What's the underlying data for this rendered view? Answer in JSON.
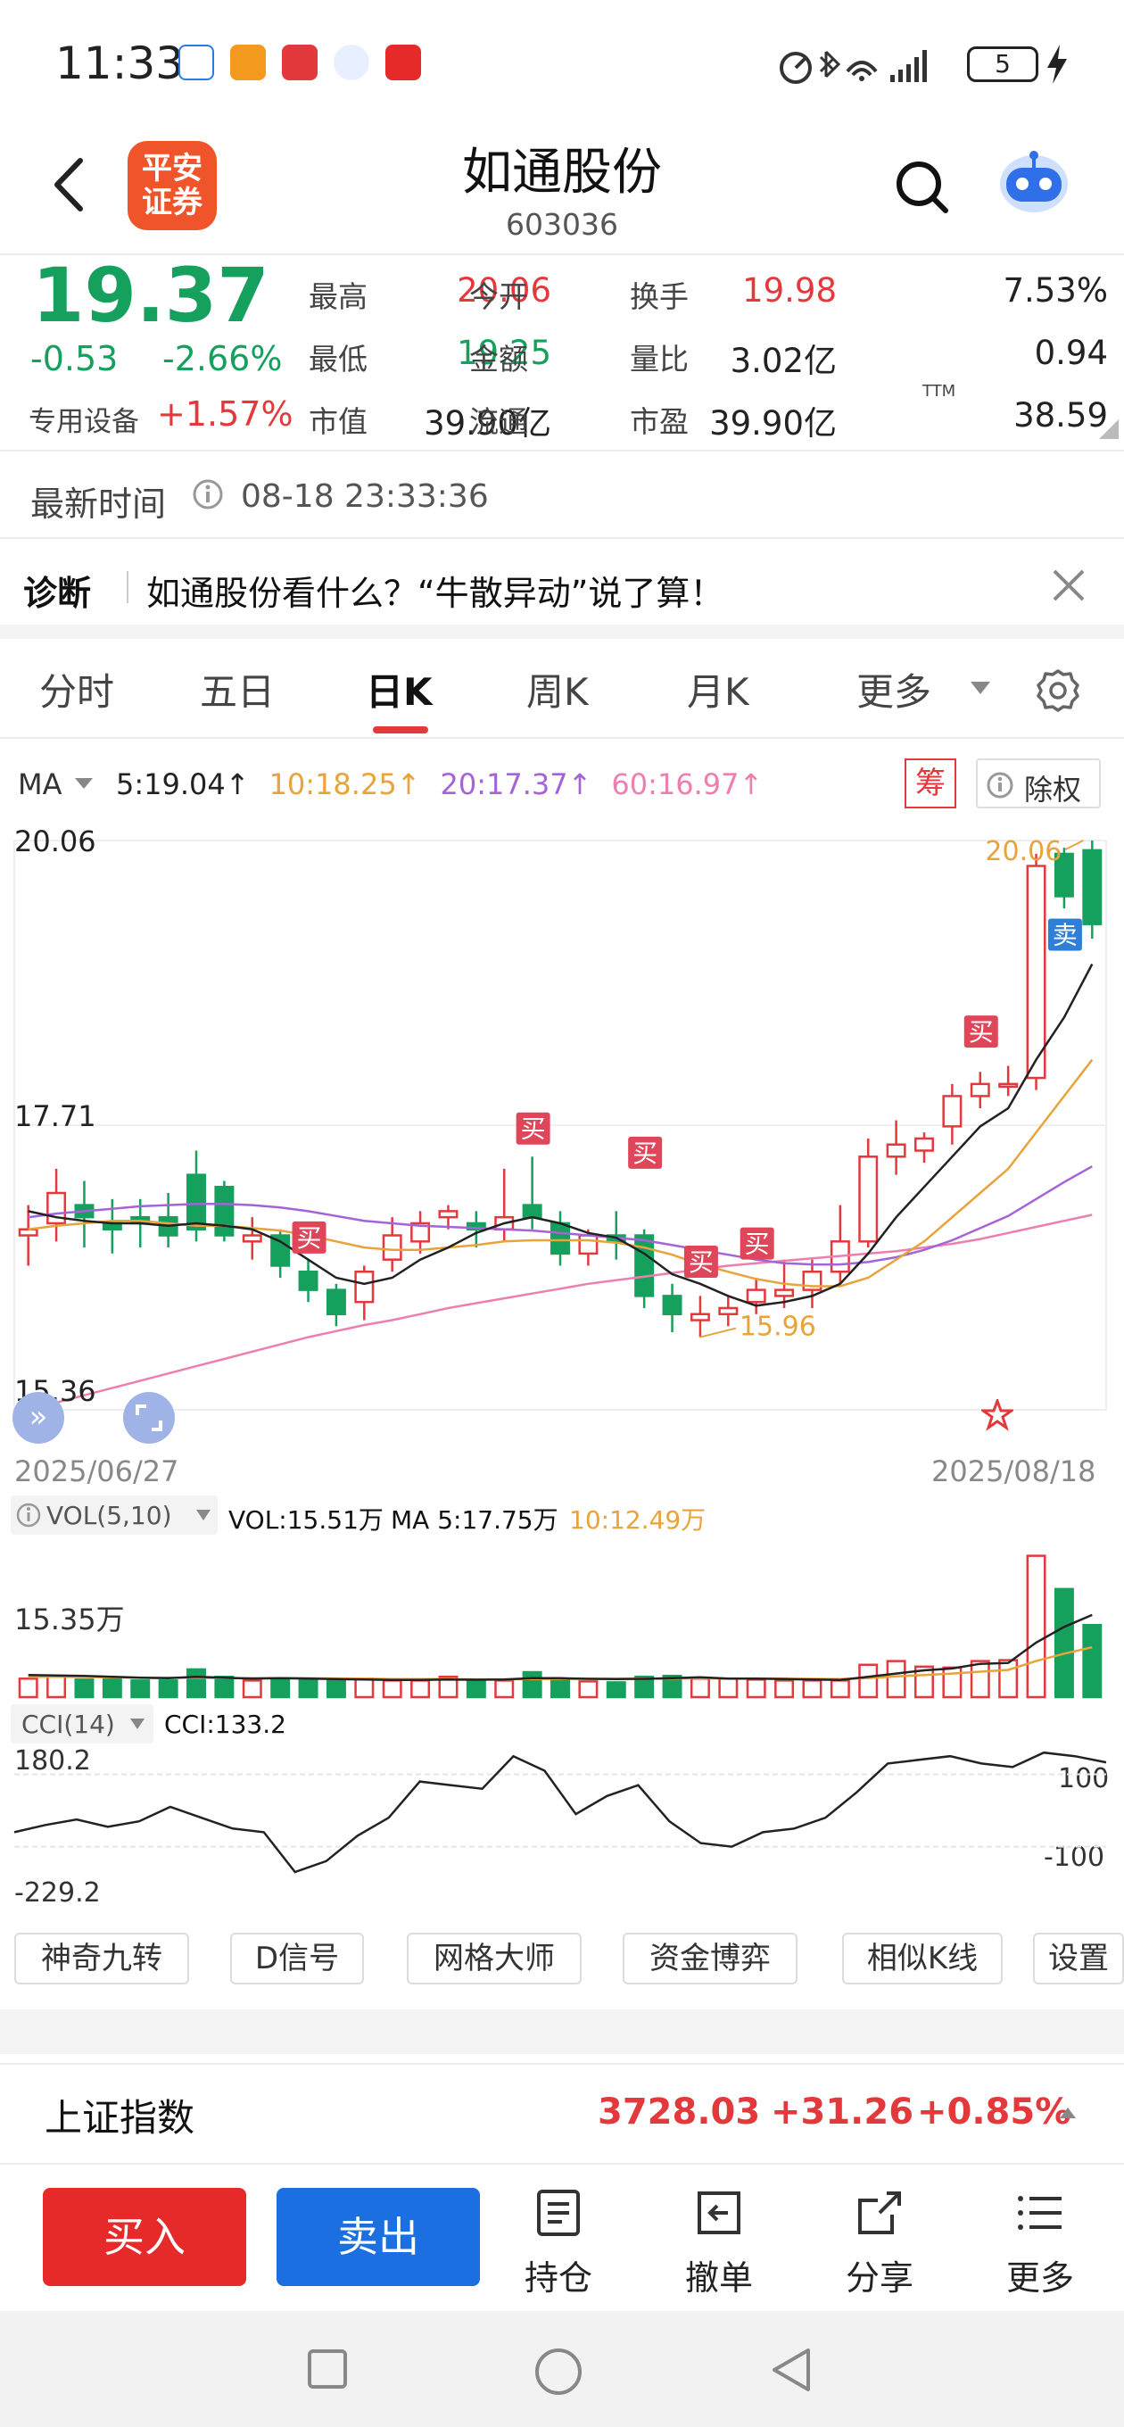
{
  "status_bar": {
    "time": "11:33",
    "battery": "5"
  },
  "header": {
    "logo_text": "平安证券",
    "stock_name": "如通股份",
    "stock_code": "603036"
  },
  "quote": {
    "price": "19.37",
    "change": "-0.53",
    "change_pct": "-2.66%",
    "sector_name": "专用设备",
    "sector_pct": "+1.57%",
    "stats": [
      {
        "label": "最高",
        "value": "20.06",
        "color": "red"
      },
      {
        "label": "今开",
        "value": "19.98",
        "color": "red"
      },
      {
        "label": "换手",
        "value": "7.53%",
        "color": "black"
      },
      {
        "label": "最低",
        "value": "19.25",
        "color": "green"
      },
      {
        "label": "金额",
        "value": "3.02亿",
        "color": "black"
      },
      {
        "label": "量比",
        "value": "0.94",
        "color": "black"
      },
      {
        "label": "市值",
        "value": "39.90亿",
        "color": "black"
      },
      {
        "label": "流通",
        "value": "39.90亿",
        "color": "black"
      },
      {
        "label": "市盈",
        "value": "38.59",
        "color": "black"
      }
    ],
    "pe_superscript": "TTM"
  },
  "latest_time": {
    "label": "最新时间",
    "value": "08-18 23:33:36"
  },
  "diagnosis": {
    "tag": "诊断",
    "text": "如通股份看什么？“牛散异动”说了算！"
  },
  "tabs": [
    "分时",
    "五日",
    "日K",
    "周K",
    "月K",
    "更多"
  ],
  "active_tab": "日K",
  "ma_legend": {
    "label": "MA",
    "items": [
      {
        "text": "5:19.04",
        "color": "#222222"
      },
      {
        "text": "10:18.25",
        "color": "#e8a33b"
      },
      {
        "text": "20:17.37",
        "color": "#a463d6"
      },
      {
        "text": "60:16.97",
        "color": "#ec7fb0"
      }
    ],
    "chip_label": "筹",
    "exright_label": "除权"
  },
  "chart_data": {
    "type": "candlestick",
    "y_ticks": [
      "20.06",
      "17.71",
      "15.36"
    ],
    "x_labels": [
      "2025/06/27",
      "2025/08/18"
    ],
    "high_marker": "20.06",
    "low_marker": "15.96",
    "buy_label": "买",
    "sell_label": "卖",
    "candles": [
      [
        16.8,
        16.85,
        16.55,
        17.05
      ],
      [
        16.9,
        17.15,
        16.75,
        17.35
      ],
      [
        17.05,
        16.95,
        16.7,
        17.25
      ],
      [
        16.9,
        16.85,
        16.65,
        17.1
      ],
      [
        16.95,
        16.9,
        16.7,
        17.1
      ],
      [
        16.95,
        16.8,
        16.7,
        17.15
      ],
      [
        17.3,
        16.85,
        16.75,
        17.5
      ],
      [
        17.2,
        16.8,
        16.75,
        17.25
      ],
      [
        16.75,
        16.8,
        16.6,
        16.95
      ],
      [
        16.8,
        16.55,
        16.45,
        16.85
      ],
      [
        16.5,
        16.35,
        16.25,
        16.6
      ],
      [
        16.35,
        16.15,
        16.05,
        16.4
      ],
      [
        16.25,
        16.5,
        16.1,
        16.55
      ],
      [
        16.6,
        16.8,
        16.5,
        16.95
      ],
      [
        16.75,
        16.9,
        16.65,
        17.0
      ],
      [
        16.95,
        17.0,
        16.85,
        17.05
      ],
      [
        16.9,
        16.85,
        16.7,
        17.0
      ],
      [
        16.85,
        16.95,
        16.75,
        17.35
      ],
      [
        17.05,
        16.95,
        16.85,
        17.45
      ],
      [
        16.9,
        16.65,
        16.55,
        17.0
      ],
      [
        16.65,
        16.8,
        16.55,
        16.85
      ],
      [
        16.8,
        16.75,
        16.6,
        17.0
      ],
      [
        16.8,
        16.3,
        16.2,
        16.85
      ],
      [
        16.3,
        16.15,
        16.0,
        16.4
      ],
      [
        16.1,
        16.15,
        15.96,
        16.3
      ],
      [
        16.15,
        16.2,
        16.05,
        16.3
      ],
      [
        16.25,
        16.35,
        16.15,
        16.45
      ],
      [
        16.3,
        16.35,
        16.2,
        16.6
      ],
      [
        16.35,
        16.5,
        16.2,
        16.6
      ],
      [
        16.5,
        16.75,
        16.4,
        17.05
      ],
      [
        16.75,
        17.45,
        16.7,
        17.6
      ],
      [
        17.45,
        17.55,
        17.3,
        17.75
      ],
      [
        17.5,
        17.6,
        17.4,
        17.65
      ],
      [
        17.7,
        17.95,
        17.55,
        18.05
      ],
      [
        17.95,
        18.05,
        17.85,
        18.15
      ],
      [
        18.05,
        18.05,
        17.95,
        18.2
      ],
      [
        18.1,
        19.85,
        18.0,
        19.95
      ],
      [
        19.95,
        19.6,
        19.5,
        20.0
      ],
      [
        19.98,
        19.37,
        19.25,
        20.06
      ]
    ],
    "ma5": [
      17.0,
      16.95,
      16.92,
      16.9,
      16.9,
      16.88,
      16.9,
      16.88,
      16.85,
      16.75,
      16.6,
      16.45,
      16.4,
      16.45,
      16.6,
      16.7,
      16.82,
      16.9,
      16.95,
      16.9,
      16.82,
      16.78,
      16.65,
      16.48,
      16.4,
      16.3,
      16.22,
      16.25,
      16.3,
      16.4,
      16.65,
      16.95,
      17.2,
      17.45,
      17.7,
      17.85,
      18.25,
      18.6,
      19.04
    ],
    "ma10": [
      16.85,
      16.88,
      16.9,
      16.92,
      16.92,
      16.9,
      16.88,
      16.88,
      16.86,
      16.84,
      16.8,
      16.75,
      16.7,
      16.68,
      16.68,
      16.7,
      16.72,
      16.75,
      16.76,
      16.76,
      16.76,
      16.74,
      16.7,
      16.64,
      16.56,
      16.5,
      16.44,
      16.4,
      16.38,
      16.38,
      16.45,
      16.6,
      16.75,
      16.95,
      17.15,
      17.35,
      17.65,
      17.95,
      18.25
    ],
    "ma20": [
      16.95,
      16.98,
      17.0,
      17.02,
      17.04,
      17.05,
      17.06,
      17.06,
      17.05,
      17.03,
      17.0,
      16.96,
      16.92,
      16.9,
      16.88,
      16.87,
      16.86,
      16.85,
      16.84,
      16.82,
      16.8,
      16.78,
      16.76,
      16.72,
      16.68,
      16.64,
      16.6,
      16.57,
      16.56,
      16.56,
      16.58,
      16.62,
      16.68,
      16.76,
      16.86,
      16.96,
      17.1,
      17.24,
      17.37
    ],
    "ma60": [
      15.36,
      15.42,
      15.48,
      15.54,
      15.6,
      15.66,
      15.72,
      15.78,
      15.84,
      15.9,
      15.96,
      16.01,
      16.06,
      16.1,
      16.15,
      16.2,
      16.24,
      16.28,
      16.32,
      16.36,
      16.4,
      16.43,
      16.46,
      16.49,
      16.52,
      16.55,
      16.57,
      16.59,
      16.61,
      16.63,
      16.65,
      16.67,
      16.7,
      16.73,
      16.77,
      16.82,
      16.87,
      16.92,
      16.97
    ],
    "signals": [
      {
        "index": 10,
        "type": "buy",
        "price": 16.65
      },
      {
        "index": 18,
        "type": "buy",
        "price": 17.55
      },
      {
        "index": 22,
        "type": "buy",
        "price": 17.35
      },
      {
        "index": 24,
        "type": "buy",
        "price": 16.45
      },
      {
        "index": 26,
        "type": "buy",
        "price": 16.6
      },
      {
        "index": 34,
        "type": "buy",
        "price": 18.35
      },
      {
        "index": 37,
        "type": "sell",
        "price": 19.15
      }
    ],
    "volume": {
      "label": "VOL(5,10)",
      "text": "VOL:15.51万",
      "ma5_text": "MA 5:17.75万",
      "ma10_text": "10:12.49万",
      "y_tick": "15.35万",
      "values": [
        2.0,
        2.3,
        1.9,
        1.9,
        1.8,
        1.8,
        3.0,
        2.2,
        1.8,
        1.9,
        1.8,
        1.8,
        2.0,
        1.8,
        1.8,
        2.2,
        1.7,
        1.8,
        2.7,
        1.9,
        1.7,
        1.6,
        2.2,
        2.3,
        2.0,
        2.0,
        1.9,
        1.8,
        1.8,
        1.8,
        3.5,
        3.9,
        3.3,
        3.2,
        3.9,
        4.0,
        15.3,
        11.7,
        7.8
      ],
      "ma5": [
        2.4,
        2.35,
        2.3,
        2.2,
        2.1,
        2.05,
        2.2,
        2.1,
        2.0,
        2.05,
        2.0,
        1.95,
        1.9,
        1.85,
        1.85,
        1.9,
        1.88,
        1.9,
        2.05,
        2.05,
        1.98,
        1.95,
        1.98,
        2.05,
        2.15,
        2.0,
        2.0,
        1.95,
        1.9,
        1.85,
        2.2,
        2.55,
        2.9,
        3.1,
        3.6,
        3.7,
        5.9,
        7.6,
        8.9
      ],
      "ma10": [
        2.2,
        2.2,
        2.2,
        2.15,
        2.1,
        2.1,
        2.1,
        2.05,
        2.05,
        2.05,
        2.05,
        2.0,
        2.0,
        1.95,
        1.95,
        1.95,
        1.92,
        1.92,
        1.95,
        1.98,
        1.98,
        1.98,
        2.0,
        2.0,
        2.05,
        2.0,
        2.0,
        2.0,
        1.98,
        1.95,
        2.05,
        2.25,
        2.4,
        2.55,
        2.75,
        2.95,
        3.9,
        4.7,
        5.4
      ]
    },
    "cci": {
      "label": "CCI(14)",
      "text": "CCI:133.2",
      "y_ticks_left": [
        "180.2",
        "-229.2"
      ],
      "y_ticks_right": [
        "100",
        "-100"
      ],
      "values": [
        -60,
        -40,
        -25,
        -45,
        -30,
        10,
        -20,
        -50,
        -60,
        -170,
        -140,
        -70,
        -20,
        80,
        70,
        60,
        150,
        110,
        -10,
        40,
        70,
        -30,
        -90,
        -100,
        -60,
        -50,
        -20,
        50,
        130,
        140,
        150,
        130,
        120,
        160,
        150,
        133.2
      ]
    }
  },
  "tools": [
    "神奇九转",
    "D信号",
    "网格大师",
    "资金博弈",
    "相似K线",
    "设置"
  ],
  "index_bar": {
    "name": "上证指数",
    "value": "3728.03",
    "change": "+31.26",
    "change_pct": "+0.85%"
  },
  "actions": {
    "buy": "买入",
    "sell": "卖出",
    "items": [
      "持仓",
      "撤单",
      "分享",
      "更多"
    ]
  }
}
